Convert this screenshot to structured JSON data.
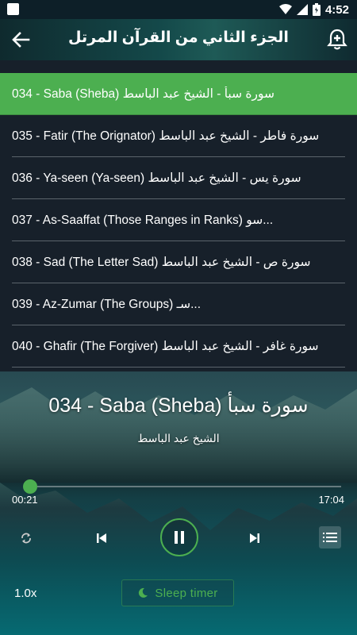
{
  "status_bar": {
    "time": "4:52"
  },
  "toolbar": {
    "title": "الجزء الثاني من القرآن المرتل"
  },
  "tracks": [
    {
      "label": "034 - Saba (Sheba) سورة سبأ - الشيخ عبد الباسط"
    },
    {
      "label": "035 - Fatir (The Orignator) سورة فاطر - الشيخ عبد الباسط"
    },
    {
      "label": "036 - Ya-seen (Ya-seen) سورة يس - الشيخ عبد الباسط"
    },
    {
      "label": "037 - As-Saaffat (Those Ranges in Ranks) سو..."
    },
    {
      "label": "038 - Sad (The Letter Sad) سورة ص - الشيخ عبد الباسط"
    },
    {
      "label": "039 - Az-Zumar (The Groups) سـ..."
    },
    {
      "label": "040 - Ghafir (The Forgiver) سورة غافر - الشيخ عبد الباسط"
    }
  ],
  "player": {
    "now_playing_title": "034 - Saba (Sheba) سورة سبأ",
    "now_playing_subtitle": "الشيخ عبد الباسط",
    "current_time": "00:21",
    "total_time": "17:04",
    "progress_fraction": 0.02,
    "speed": "1.0x",
    "sleep_timer_label": "Sleep timer"
  },
  "colors": {
    "accent": "#4caf50",
    "list_bg": "#17202a",
    "divider": "#5b646c"
  }
}
